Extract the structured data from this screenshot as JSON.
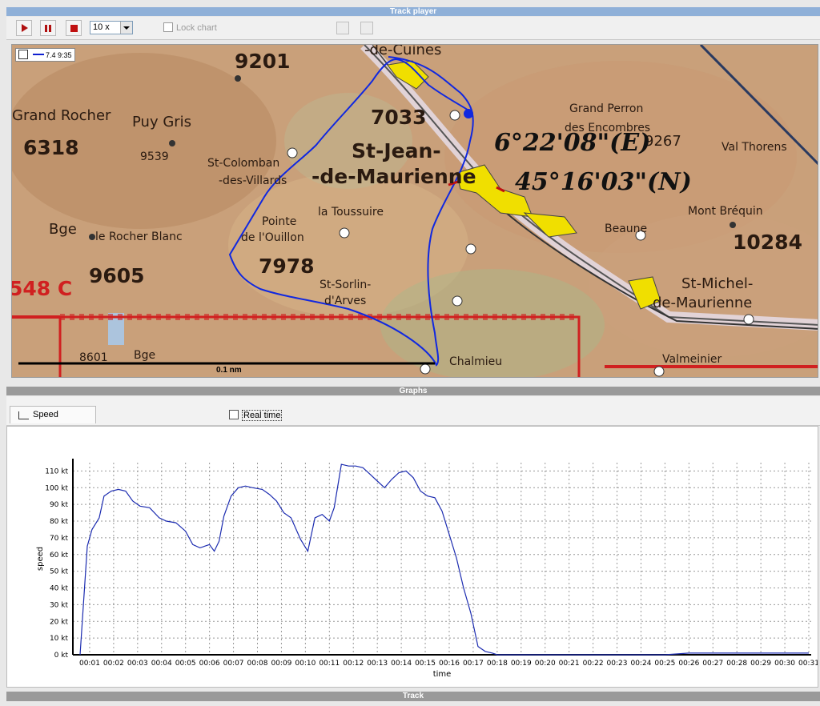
{
  "panels": {
    "track_player_title": "Track player",
    "graphs_title": "Graphs",
    "track_title": "Track"
  },
  "toolbar": {
    "speed_value": "10 x",
    "lock_chart_label": "Lock chart",
    "icons": [
      "play-icon",
      "pause-icon",
      "stop-icon",
      "zoom-fit-icon",
      "copy-icon"
    ]
  },
  "map": {
    "legend": {
      "checked": true,
      "label": "7.4 9:35",
      "line_color": "#1020d0"
    },
    "scale_label": "0.1 nm",
    "labels": {
      "grand_rocher": "Grand Rocher",
      "n6318": "6318",
      "puy_gris": "Puy Gris",
      "n9539": "9539",
      "n9201": "9201",
      "n7033": "7033",
      "st_jean_1": "St-Jean-",
      "st_jean_2": "-de-Maurienne",
      "st_colomban_1": "St-Colomban",
      "st_colomban_2": "-des-Villards",
      "la_toussuire": "la Toussuire",
      "pointe_1": "Pointe",
      "pointe_2": "de l'Ouillon",
      "n7978": "7978",
      "st_sorlin_1": "St-Sorlin-",
      "st_sorlin_2": "d'Arves",
      "bge": "Bge",
      "le_rocher_blanc": "le Rocher Blanc",
      "n9605": "9605",
      "zone_548c": "548 C",
      "n8601": "8601",
      "bge2": "Bge",
      "chalmieu": "Chalmieu",
      "grand_perron_1": "Grand Perron",
      "grand_perron_2": "des Encombres",
      "n9267": "9267",
      "val_thorens": "Val Thorens",
      "mont_brequin": "Mont Bréquin",
      "n10284": "10284",
      "beaune": "Beaune",
      "st_michel_1": "St-Michel-",
      "st_michel_2": "de-Maurienne",
      "valmeinier": "Valmeinier",
      "de_cuines": "-de-Cuines",
      "hand_lon": "6°22'08\"(E)",
      "hand_lat": "45°16'03\"(N)"
    }
  },
  "graphs": {
    "tab_speed": "Speed",
    "realtime_label": "Real time",
    "realtime_checked": false
  },
  "chart_data": {
    "type": "line",
    "title": "",
    "xlabel": "time",
    "ylabel": "speed",
    "ylim": [
      0,
      115
    ],
    "yticks": [
      "0 kt",
      "10 kt",
      "20 kt",
      "30 kt",
      "40 kt",
      "50 kt",
      "60 kt",
      "70 kt",
      "80 kt",
      "90 kt",
      "100 kt",
      "110 kt"
    ],
    "x_ticks": [
      "00:01",
      "00:02",
      "00:03",
      "00:04",
      "00:05",
      "00:06",
      "00:07",
      "00:08",
      "00:09",
      "00:10",
      "00:11",
      "00:12",
      "00:13",
      "00:14",
      "00:15",
      "00:16",
      "00:17",
      "00:18",
      "00:19",
      "00:20",
      "00:21",
      "00:22",
      "00:23",
      "00:24",
      "00:25",
      "00:26",
      "00:27",
      "00:28",
      "00:29",
      "00:30",
      "00:31"
    ],
    "grid": true,
    "series": [
      {
        "color": "#1c2cb0",
        "x_minutes": [
          0.6,
          0.9,
          1.1,
          1.4,
          1.6,
          1.9,
          2.2,
          2.5,
          2.8,
          3.1,
          3.5,
          3.9,
          4.2,
          4.6,
          5.0,
          5.3,
          5.6,
          6.0,
          6.2,
          6.4,
          6.6,
          6.9,
          7.2,
          7.5,
          7.8,
          8.2,
          8.5,
          8.8,
          9.1,
          9.4,
          9.8,
          10.1,
          10.4,
          10.7,
          11.0,
          11.2,
          11.5,
          11.8,
          12.1,
          12.4,
          12.7,
          13.0,
          13.3,
          13.6,
          13.9,
          14.2,
          14.5,
          14.8,
          15.1,
          15.4,
          15.7,
          16.0,
          16.3,
          16.6,
          16.9,
          17.2,
          17.5,
          17.8,
          18.0,
          18.2,
          18.4,
          18.6,
          19,
          20,
          22,
          24,
          25,
          26,
          27,
          28,
          29,
          30,
          31
        ],
        "y": [
          0,
          65,
          75,
          82,
          95,
          98,
          99,
          98,
          92,
          89,
          88,
          82,
          80,
          79,
          74,
          66,
          64,
          66,
          62,
          68,
          83,
          95,
          100,
          101,
          100,
          99,
          96,
          92,
          85,
          82,
          69,
          62,
          82,
          84,
          80,
          88,
          114,
          113,
          113,
          112,
          108,
          104,
          100,
          105,
          109,
          110,
          106,
          98,
          95,
          94,
          86,
          72,
          58,
          40,
          25,
          5,
          2,
          1,
          0,
          0,
          0,
          0,
          0,
          0,
          0,
          0,
          0,
          1,
          1,
          1,
          1,
          1,
          1
        ]
      }
    ]
  }
}
